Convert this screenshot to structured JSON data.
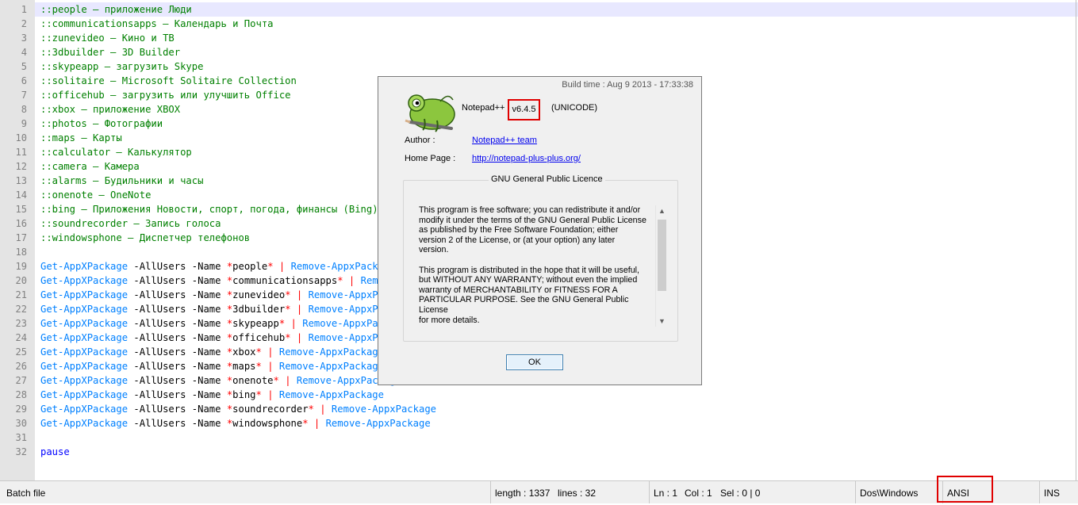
{
  "editor": {
    "lines": [
      {
        "n": "1",
        "current": true,
        "tokens": [
          {
            "c": "t-comment",
            "t": "::people — приложение Люди"
          }
        ]
      },
      {
        "n": "2",
        "tokens": [
          {
            "c": "t-comment",
            "t": "::communicationsapps — Календарь и Почта"
          }
        ]
      },
      {
        "n": "3",
        "tokens": [
          {
            "c": "t-comment",
            "t": "::zunevideo — Кино и ТВ"
          }
        ]
      },
      {
        "n": "4",
        "tokens": [
          {
            "c": "t-comment",
            "t": "::3dbuilder — 3D Builder"
          }
        ]
      },
      {
        "n": "5",
        "tokens": [
          {
            "c": "t-comment",
            "t": "::skypeapp — загрузить Skype"
          }
        ]
      },
      {
        "n": "6",
        "tokens": [
          {
            "c": "t-comment",
            "t": "::solitaire — Microsoft Solitaire Collection"
          }
        ]
      },
      {
        "n": "7",
        "tokens": [
          {
            "c": "t-comment",
            "t": "::officehub — загрузить или улучшить Office"
          }
        ]
      },
      {
        "n": "8",
        "tokens": [
          {
            "c": "t-comment",
            "t": "::xbox — приложение XBOX"
          }
        ]
      },
      {
        "n": "9",
        "tokens": [
          {
            "c": "t-comment",
            "t": "::photos — Фотографии"
          }
        ]
      },
      {
        "n": "10",
        "tokens": [
          {
            "c": "t-comment",
            "t": "::maps — Карты"
          }
        ]
      },
      {
        "n": "11",
        "tokens": [
          {
            "c": "t-comment",
            "t": "::calculator — Калькулятор"
          }
        ]
      },
      {
        "n": "12",
        "tokens": [
          {
            "c": "t-comment",
            "t": "::camera — Камера"
          }
        ]
      },
      {
        "n": "13",
        "tokens": [
          {
            "c": "t-comment",
            "t": "::alarms — Будильники и часы"
          }
        ]
      },
      {
        "n": "14",
        "tokens": [
          {
            "c": "t-comment",
            "t": "::onenote — OneNote"
          }
        ]
      },
      {
        "n": "15",
        "tokens": [
          {
            "c": "t-comment",
            "t": "::bing — Приложения Новости, спорт, погода, финансы (Bing)"
          }
        ]
      },
      {
        "n": "16",
        "tokens": [
          {
            "c": "t-comment",
            "t": "::soundrecorder — Запись голоса"
          }
        ]
      },
      {
        "n": "17",
        "tokens": [
          {
            "c": "t-comment",
            "t": "::windowsphone — Диспетчер телефонов"
          }
        ]
      },
      {
        "n": "18",
        "tokens": []
      },
      {
        "n": "19",
        "tokens": [
          {
            "c": "t-cmd",
            "t": "Get-AppXPackage"
          },
          {
            "c": "t-plain",
            "t": " -AllUsers -Name "
          },
          {
            "c": "t-op",
            "t": "*"
          },
          {
            "c": "t-plain",
            "t": "people"
          },
          {
            "c": "t-op",
            "t": "*"
          },
          {
            "c": "t-plain",
            "t": " "
          },
          {
            "c": "t-op",
            "t": "|"
          },
          {
            "c": "t-plain",
            "t": " "
          },
          {
            "c": "t-cmd",
            "t": "Remove-AppxPackage"
          }
        ]
      },
      {
        "n": "20",
        "tokens": [
          {
            "c": "t-cmd",
            "t": "Get-AppXPackage"
          },
          {
            "c": "t-plain",
            "t": " -AllUsers -Name "
          },
          {
            "c": "t-op",
            "t": "*"
          },
          {
            "c": "t-plain",
            "t": "communicationsapps"
          },
          {
            "c": "t-op",
            "t": "*"
          },
          {
            "c": "t-plain",
            "t": " "
          },
          {
            "c": "t-op",
            "t": "|"
          },
          {
            "c": "t-plain",
            "t": " "
          },
          {
            "c": "t-cmd",
            "t": "Remove-AppxPackage"
          }
        ]
      },
      {
        "n": "21",
        "tokens": [
          {
            "c": "t-cmd",
            "t": "Get-AppXPackage"
          },
          {
            "c": "t-plain",
            "t": " -AllUsers -Name "
          },
          {
            "c": "t-op",
            "t": "*"
          },
          {
            "c": "t-plain",
            "t": "zunevideo"
          },
          {
            "c": "t-op",
            "t": "*"
          },
          {
            "c": "t-plain",
            "t": " "
          },
          {
            "c": "t-op",
            "t": "|"
          },
          {
            "c": "t-plain",
            "t": " "
          },
          {
            "c": "t-cmd",
            "t": "Remove-AppxPackage"
          }
        ]
      },
      {
        "n": "22",
        "tokens": [
          {
            "c": "t-cmd",
            "t": "Get-AppXPackage"
          },
          {
            "c": "t-plain",
            "t": " -AllUsers -Name "
          },
          {
            "c": "t-op",
            "t": "*"
          },
          {
            "c": "t-plain",
            "t": "3dbuilder"
          },
          {
            "c": "t-op",
            "t": "*"
          },
          {
            "c": "t-plain",
            "t": " "
          },
          {
            "c": "t-op",
            "t": "|"
          },
          {
            "c": "t-plain",
            "t": " "
          },
          {
            "c": "t-cmd",
            "t": "Remove-AppxPackage"
          }
        ]
      },
      {
        "n": "23",
        "tokens": [
          {
            "c": "t-cmd",
            "t": "Get-AppXPackage"
          },
          {
            "c": "t-plain",
            "t": " -AllUsers -Name "
          },
          {
            "c": "t-op",
            "t": "*"
          },
          {
            "c": "t-plain",
            "t": "skypeapp"
          },
          {
            "c": "t-op",
            "t": "*"
          },
          {
            "c": "t-plain",
            "t": " "
          },
          {
            "c": "t-op",
            "t": "|"
          },
          {
            "c": "t-plain",
            "t": " "
          },
          {
            "c": "t-cmd",
            "t": "Remove-AppxPackage"
          }
        ]
      },
      {
        "n": "24",
        "tokens": [
          {
            "c": "t-cmd",
            "t": "Get-AppXPackage"
          },
          {
            "c": "t-plain",
            "t": " -AllUsers -Name "
          },
          {
            "c": "t-op",
            "t": "*"
          },
          {
            "c": "t-plain",
            "t": "officehub"
          },
          {
            "c": "t-op",
            "t": "*"
          },
          {
            "c": "t-plain",
            "t": " "
          },
          {
            "c": "t-op",
            "t": "|"
          },
          {
            "c": "t-plain",
            "t": " "
          },
          {
            "c": "t-cmd",
            "t": "Remove-AppxPackage"
          }
        ]
      },
      {
        "n": "25",
        "tokens": [
          {
            "c": "t-cmd",
            "t": "Get-AppXPackage"
          },
          {
            "c": "t-plain",
            "t": " -AllUsers -Name "
          },
          {
            "c": "t-op",
            "t": "*"
          },
          {
            "c": "t-plain",
            "t": "xbox"
          },
          {
            "c": "t-op",
            "t": "*"
          },
          {
            "c": "t-plain",
            "t": " "
          },
          {
            "c": "t-op",
            "t": "|"
          },
          {
            "c": "t-plain",
            "t": " "
          },
          {
            "c": "t-cmd",
            "t": "Remove-AppxPackage"
          }
        ]
      },
      {
        "n": "26",
        "tokens": [
          {
            "c": "t-cmd",
            "t": "Get-AppXPackage"
          },
          {
            "c": "t-plain",
            "t": " -AllUsers -Name "
          },
          {
            "c": "t-op",
            "t": "*"
          },
          {
            "c": "t-plain",
            "t": "maps"
          },
          {
            "c": "t-op",
            "t": "*"
          },
          {
            "c": "t-plain",
            "t": " "
          },
          {
            "c": "t-op",
            "t": "|"
          },
          {
            "c": "t-plain",
            "t": " "
          },
          {
            "c": "t-cmd",
            "t": "Remove-AppxPackage"
          }
        ]
      },
      {
        "n": "27",
        "tokens": [
          {
            "c": "t-cmd",
            "t": "Get-AppXPackage"
          },
          {
            "c": "t-plain",
            "t": " -AllUsers -Name "
          },
          {
            "c": "t-op",
            "t": "*"
          },
          {
            "c": "t-plain",
            "t": "onenote"
          },
          {
            "c": "t-op",
            "t": "*"
          },
          {
            "c": "t-plain",
            "t": " "
          },
          {
            "c": "t-op",
            "t": "|"
          },
          {
            "c": "t-plain",
            "t": " "
          },
          {
            "c": "t-cmd",
            "t": "Remove-AppxPackage"
          }
        ]
      },
      {
        "n": "28",
        "tokens": [
          {
            "c": "t-cmd",
            "t": "Get-AppXPackage"
          },
          {
            "c": "t-plain",
            "t": " -AllUsers -Name "
          },
          {
            "c": "t-op",
            "t": "*"
          },
          {
            "c": "t-plain",
            "t": "bing"
          },
          {
            "c": "t-op",
            "t": "*"
          },
          {
            "c": "t-plain",
            "t": " "
          },
          {
            "c": "t-op",
            "t": "|"
          },
          {
            "c": "t-plain",
            "t": " "
          },
          {
            "c": "t-cmd",
            "t": "Remove-AppxPackage"
          }
        ]
      },
      {
        "n": "29",
        "tokens": [
          {
            "c": "t-cmd",
            "t": "Get-AppXPackage"
          },
          {
            "c": "t-plain",
            "t": " -AllUsers -Name "
          },
          {
            "c": "t-op",
            "t": "*"
          },
          {
            "c": "t-plain",
            "t": "soundrecorder"
          },
          {
            "c": "t-op",
            "t": "*"
          },
          {
            "c": "t-plain",
            "t": " "
          },
          {
            "c": "t-op",
            "t": "|"
          },
          {
            "c": "t-plain",
            "t": " "
          },
          {
            "c": "t-cmd",
            "t": "Remove-AppxPackage"
          }
        ]
      },
      {
        "n": "30",
        "tokens": [
          {
            "c": "t-cmd",
            "t": "Get-AppXPackage"
          },
          {
            "c": "t-plain",
            "t": " -AllUsers -Name "
          },
          {
            "c": "t-op",
            "t": "*"
          },
          {
            "c": "t-plain",
            "t": "windowsphone"
          },
          {
            "c": "t-op",
            "t": "*"
          },
          {
            "c": "t-plain",
            "t": " "
          },
          {
            "c": "t-op",
            "t": "|"
          },
          {
            "c": "t-plain",
            "t": " "
          },
          {
            "c": "t-cmd",
            "t": "Remove-AppxPackage"
          }
        ]
      },
      {
        "n": "31",
        "tokens": []
      },
      {
        "n": "32",
        "tokens": [
          {
            "c": "t-kw",
            "t": "pause"
          }
        ]
      }
    ]
  },
  "statusbar": {
    "language": "Batch file",
    "length": "length : 1337",
    "lines": "lines : 32",
    "ln": "Ln : 1",
    "col": "Col : 1",
    "sel": "Sel : 0 | 0",
    "eol": "Dos\\Windows",
    "encoding": "ANSI",
    "mode": "INS"
  },
  "about": {
    "build_time": "Build time : Aug  9 2013 - 17:33:38",
    "app_name": "Notepad++",
    "version": "v6.4.5",
    "charset": "(UNICODE)",
    "author_label": "Author :",
    "author_link": "Notepad++ team",
    "homepage_label": "Home Page :",
    "homepage_link": "http://notepad-plus-plus.org/",
    "licence_title": "GNU General Public Licence",
    "licence_p1": "This program is free software; you can redistribute it and/or\nmodify it under the terms of the GNU General Public License\nas published by the Free Software Foundation; either\nversion 2 of the License, or (at your option) any later\nversion.",
    "licence_p2": "This program is distributed in the hope that it will be useful,\nbut WITHOUT ANY WARRANTY; without even the implied\nwarranty of MERCHANTABILITY or FITNESS FOR A\nPARTICULAR PURPOSE.  See the GNU General Public License\nfor more details.",
    "ok_label": "OK",
    "logo_icon": "chameleon-logo-icon"
  },
  "colors": {
    "comment": "#008000",
    "command": "#0080ff",
    "operator": "#ff0000",
    "keyword": "#0000ff",
    "highlight_box": "#e00000",
    "current_line": "#e8e8ff"
  }
}
